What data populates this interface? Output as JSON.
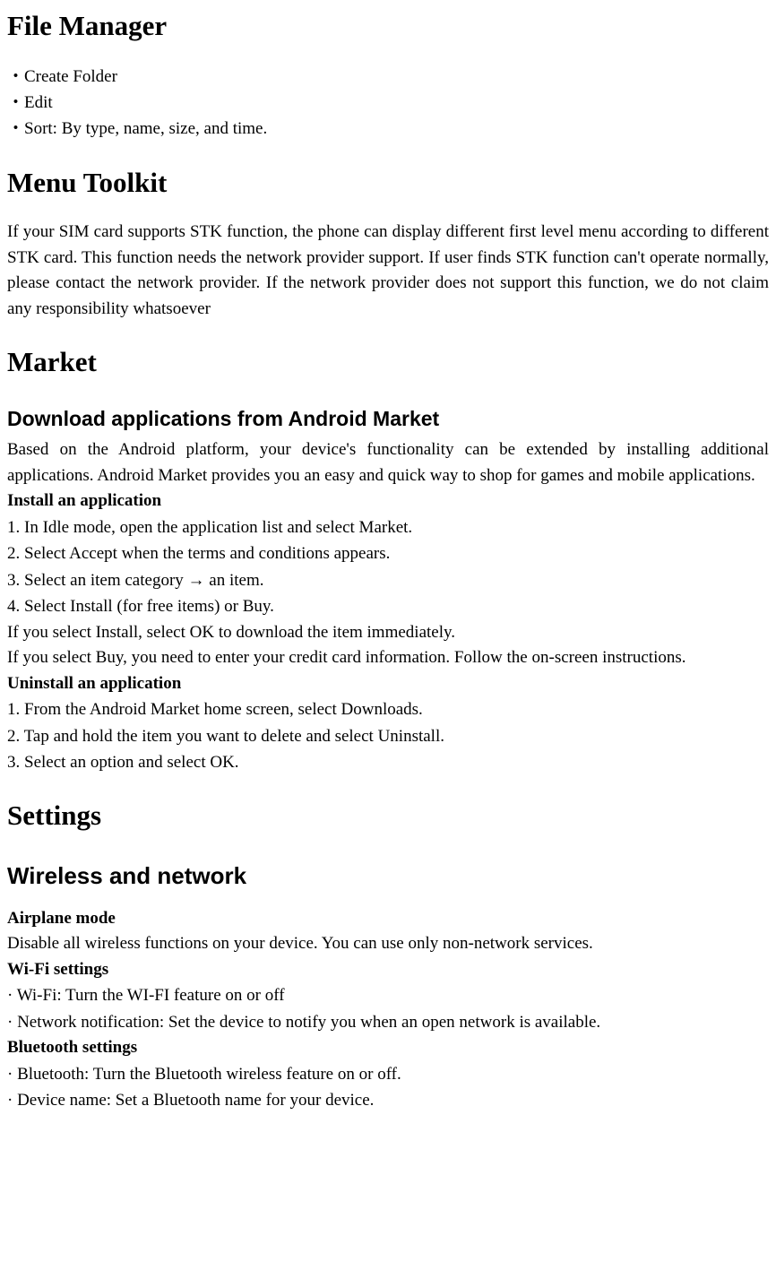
{
  "fileManager": {
    "heading": "File Manager",
    "items": [
      "・Create Folder",
      "・Edit",
      "・Sort: By type, name, size, and time."
    ]
  },
  "menuToolkit": {
    "heading": "Menu Toolkit",
    "body": "If your SIM card supports STK function, the phone can display different first level menu according to different STK card. This function needs the network provider support. If user finds STK function can't operate normally, please contact the network provider. If the network provider does not support this function, we do not claim any responsibility whatsoever"
  },
  "market": {
    "heading": "Market",
    "subheading": "Download applications from Android Market",
    "intro": "Based on the Android platform, your device's functionality can be extended by installing additional applications. Android Market provides you an easy and quick way to shop for games and mobile applications.",
    "installHeading": "Install an application",
    "installSteps": [
      "1. In Idle mode, open the application list and select Market.",
      "2. Select Accept when the terms and conditions appears.",
      "3. Select an item category  →  an item.",
      "4. Select Install (for free items) or Buy."
    ],
    "installNote1": "If you select Install, select OK to download the item immediately.",
    "installNote2": "If you select Buy, you need to enter your credit card information. Follow the on-screen instructions.",
    "uninstallHeading": "Uninstall an application",
    "uninstallSteps": [
      "1. From the Android Market home screen, select Downloads.",
      "2. Tap and hold the item you want to delete and select Uninstall.",
      "3. Select an option and select OK."
    ]
  },
  "settings": {
    "heading": "Settings",
    "wireless": {
      "heading": "Wireless and network",
      "airplaneHeading": "Airplane mode",
      "airplaneBody": "Disable all wireless functions on your device. You can use only non-network services.",
      "wifiHeading": "Wi-Fi settings",
      "wifiItems": [
        "·  Wi-Fi: Turn the WI-FI feature on or off",
        "·  Network notification: Set the device to notify you when an open network is available."
      ],
      "btHeading": "Bluetooth settings",
      "btItems": [
        "·  Bluetooth: Turn the Bluetooth wireless feature on or off.",
        "·  Device name: Set a Bluetooth name for your device."
      ]
    }
  }
}
